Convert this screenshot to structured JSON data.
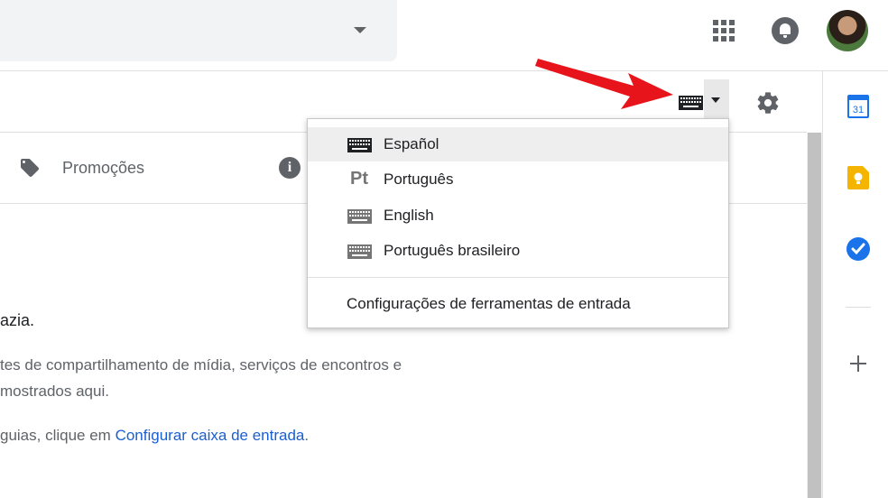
{
  "header": {
    "apps_icon": "apps-grid-icon",
    "notifications_icon": "bell-icon",
    "avatar": "user-avatar"
  },
  "toolbar": {
    "input_tools_icon": "keyboard-icon",
    "settings_icon": "gear-icon"
  },
  "tabs": [
    {
      "label": "Promoções",
      "icon": "tag-icon"
    }
  ],
  "info_icon_glyph": "i",
  "body": {
    "line1": "azia.",
    "line2": "tes de compartilhamento de mídia, serviços de encontros e",
    "line3": "mostrados aqui.",
    "line4_prefix": "guias, clique em ",
    "line4_link": "Configurar caixa de entrada",
    "line4_suffix": "."
  },
  "input_menu": {
    "items": [
      {
        "label": "Español",
        "icon": "keyboard-icon",
        "selected": true
      },
      {
        "label": "Português",
        "icon_text": "Pt",
        "selected": false
      },
      {
        "label": "English",
        "icon": "keyboard-icon",
        "selected": false
      },
      {
        "label": "Português brasileiro",
        "icon": "keyboard-icon",
        "selected": false
      }
    ],
    "footer": "Configurações de ferramentas de entrada"
  },
  "side_panel": {
    "calendar_day": "31"
  },
  "colors": {
    "link": "#1a5fd0",
    "annotation_arrow": "#e8141b",
    "tasks_blue": "#1a73e8",
    "keep_yellow": "#f4b400"
  }
}
